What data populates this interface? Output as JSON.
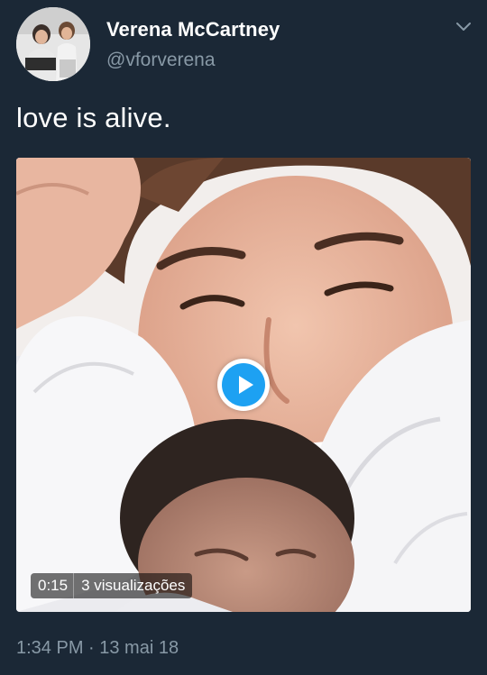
{
  "tweet": {
    "author_name": "Verena McCartney",
    "author_handle": "@vforverena",
    "text": "love is alive.",
    "timestamp": "1:34 PM · 13 mai 18"
  },
  "video": {
    "duration": "0:15",
    "views": "3 visualizações"
  },
  "colors": {
    "background": "#1b2836",
    "text_primary": "#ffffff",
    "text_secondary": "#8899a6",
    "accent": "#1da1f2"
  },
  "icons": {
    "menu": "chevron-down-icon",
    "play": "play-icon"
  }
}
